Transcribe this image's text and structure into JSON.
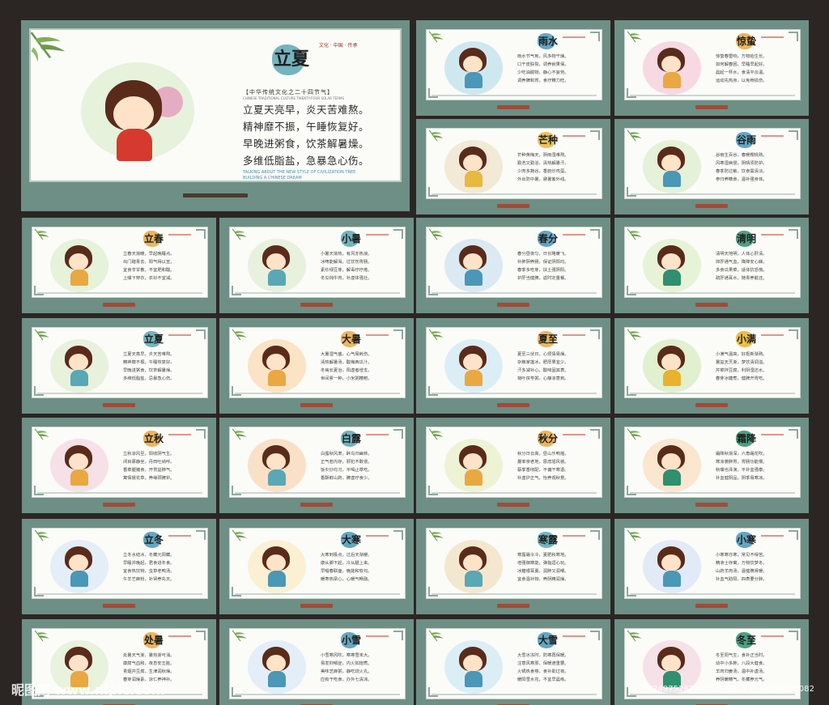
{
  "main_board": {
    "term": "立夏",
    "head_cn": "【中华传统文化之二十四节气】",
    "head_en": "CHINESE TRADITIONAL CULTURE TWENTY-FOUR SOLAR TERMS",
    "poem": [
      "立夏天亮早，炎天苦难熬。",
      "精神靡不振，午睡恢复好。",
      "早晚进粥食，饮茶解暑燥。",
      "多维低脂盐，急暴急心伤。"
    ],
    "tag_en_1": "TALKING ABOUT THE NEW STYLE OF CIVILIZATION TREE",
    "tag_en_2": "BUILDING A CHINESE DREAM",
    "seal": "文化 · 中国 · 传承"
  },
  "boards": [
    {
      "term": "雨水",
      "lines": [
        "雨水节气到，风多物干燥。",
        "口干皮肤裂，调养就果保。",
        "少吃油腻物，静心不妄劳。",
        "调养脾和胃，食疗精力旺。"
      ],
      "char": "boy-leaf",
      "splash": "#cfe8f0",
      "blob": "#4a97b7"
    },
    {
      "term": "惊蛰",
      "lines": [
        "惊蛰春雷响，万物始生长。",
        "如何解春困，早睡早起好。",
        "晨起一杯水，食清平淡温。",
        "运动先热身，以免骨损伤。"
      ],
      "char": "girl-red",
      "splash": "#f6d9e3",
      "blob": "#e9a842"
    },
    {
      "term": "芒种",
      "lines": [
        "芒种黄梅天，阴雨湿难熬。",
        "勤洗又勤浴，清热解暑汗。",
        "少肉多蔬谷，香韵炒鸡蛋。",
        "外出防中暑，避暑紫外线。"
      ],
      "char": "cow",
      "splash": "#f2e9d6",
      "blob": "#e8b840"
    },
    {
      "term": "谷雨",
      "lines": [
        "谷雨生百谷，春暖樱桃熟。",
        "风寒湿病侵，阴晴须防护。",
        "春季防过敏，饮食需清淡。",
        "参归养精食，温补强身体。"
      ],
      "char": "hat-boy",
      "splash": "#e5f1d8",
      "blob": "#4a97b7"
    },
    {
      "term": "立春",
      "lines": [
        "立春天渐暖，早起晚睡点。",
        "出门踏青去，阳气得以宣。",
        "宜食辛甘散，不宜肥和酸。",
        "上嘴下穿衣，衣衫不宜减。"
      ],
      "char": "girl-bun",
      "splash": "#e6f2d9",
      "blob": "#e9a842"
    },
    {
      "term": "小暑",
      "lines": [
        "小暑天渐热，有风亦热浪。",
        "冰啤能解渴，过饮伤胃肠。",
        "素炒绿豆芽，解毒疗疗疮。",
        "冬瓜炖牛肉，补虚体强壮。"
      ],
      "char": "girl-helmet",
      "splash": "#e8f1de",
      "blob": "#5aa7b5"
    },
    {
      "term": "春分",
      "lines": [
        "春分昼夜匀，日长略暖飞。",
        "补肺阴养肠，保证阴阳均。",
        "春季多吃芽，扶土强阴阳。",
        "护肝当健脾，返时定量餐。"
      ],
      "char": "sheep",
      "splash": "#dbe9f3",
      "blob": "#4a97b7"
    },
    {
      "term": "清明",
      "lines": [
        "清明天地明，人体心肝清。",
        "抑肝通气血，降降安心寐。",
        "多食瓜果菜，适体抗恐慌。",
        "疏肝通耳水，随青养脏还。"
      ],
      "char": "green-boy",
      "splash": "#e7f3d6",
      "blob": "#2f8f6e"
    },
    {
      "term": "立夏",
      "lines": [
        "立夏天亮早，炎天苦难熬。",
        "精神靡不振，午睡恢复好。",
        "早晚进粥食，饮茶解暑燥。",
        "多维低脂盐，忌暴急心伤。"
      ],
      "char": "girl-bun-red",
      "splash": "#e8f1dc",
      "blob": "#5aa7b5"
    },
    {
      "term": "大暑",
      "lines": [
        "大暑湿气盛，心气易耗伤。",
        "清热解暑汤，酸梅西瓜汁。",
        "冬病长夏治，阳虚者增支。",
        "世间累一种，小米粥糟粑。"
      ],
      "char": "umbrella",
      "splash": "#fbe3c6",
      "blob": "#e9a842"
    },
    {
      "term": "夏至",
      "lines": [
        "夏至三伏日，心烦情易燥。",
        "杂粮家莲冰，肥厚果宜少。",
        "汗多减补心，酸味固其表。",
        "荷叶茯苓粥，心静凉意到。"
      ],
      "char": "watermelon",
      "splash": "#dbeef6",
      "blob": "#e9a842"
    },
    {
      "term": "小满",
      "lines": [
        "小满气温高，好枢新渐熟。",
        "暑益天烹渐，梦饮清调溢。",
        "芹菜拌豆腐，利阴湿还水。",
        "春芽冰糖煮，健脾开胃吃。"
      ],
      "char": "farmer",
      "splash": "#e1f0cf",
      "blob": "#e9b22c"
    },
    {
      "term": "立秋",
      "lines": [
        "立秋凉风至，阳收阴气生。",
        "闭目慕静坐，丹田吐纳呼。",
        "香菜腿猪食，开胃益肺气。",
        "寓情嬉花草，养缘颈脾护。"
      ],
      "char": "girl-bun-red",
      "splash": "#f6e1e9",
      "blob": "#e9a842"
    },
    {
      "term": "白露",
      "lines": [
        "白露秋风肃，醉鸟归幽林。",
        "正气若内存，邪犯不敢侵。",
        "饭炎炒均习，平喝止草吃。",
        "香酥鲜山药，脾虚疗食少。"
      ],
      "char": "girl-helmet",
      "splash": "#fbe0c8",
      "blob": "#5aa7b5"
    },
    {
      "term": "秋分",
      "lines": [
        "秋分日云高，昼山乐鸭摇。",
        "蔓率亲老地，恩虑旭风装。",
        "蔡季香彻配，不偏干寒退。",
        "补虚护正气，怡养观秋景。"
      ],
      "char": "frog",
      "splash": "#eef3d6",
      "blob": "#e9a842"
    },
    {
      "term": "霜降",
      "lines": [
        "霜降秋渐深，六角霜花吹。",
        "寒凉袭肺胃，胃肠功能慢。",
        "秋嘴也泽演，平补宜强泰。",
        "补血健阴品，阴季易寒凉。"
      ],
      "char": "blond-boy",
      "splash": "#fbe6cf",
      "blob": "#2f8f6e"
    },
    {
      "term": "立冬",
      "lines": [
        "立冬水结冰，冬藏元阳藏。",
        "早睡并晚起，君食进冬食。",
        "宜食热饮物，虫草老鸭汤。",
        "午羊艺麻粉，补肾养先天。"
      ],
      "char": "girl-pink",
      "splash": "#e4eef8",
      "blob": "#4a97b7"
    },
    {
      "term": "大寒",
      "lines": [
        "大寒到极点，过后天渐暖。",
        "康从脚下起，冷从腿上来。",
        "早唱春联面，晚能和软句。",
        "暖寿热梁心，心暖气畅融。"
      ],
      "char": "girl-helmet",
      "splash": "#fbf0d4",
      "blob": "#4a97b7"
    },
    {
      "term": "寒露",
      "lines": [
        "寒露霜令冷，夏肥秋寒地。",
        "增强御寒能，弹指逗心玩。",
        "冰糖银耳羹，润肺又润喉。",
        "宜食温补物，养阴精润燥。"
      ],
      "char": "kids-play",
      "splash": "#f3e7cf",
      "blob": "#5aa7b5"
    },
    {
      "term": "小寒",
      "lines": [
        "小寒寒亦寒，常见不得苦。",
        "精液士存寓，万物饮梦冬。",
        "山药羊肉汤，温健脾肾暖。",
        "补血气助阳，四表要分肿。"
      ],
      "char": "girl-bun-red",
      "splash": "#e1eaf6",
      "blob": "#4a97b7"
    },
    {
      "term": "处暑",
      "lines": [
        "处暑天气渐，暑热渐可消。",
        "康腐气血和，夜息安五脏。",
        "青烟并豆腐，生津润秋燥。",
        "春芽润燥素，凉仁养神补。"
      ],
      "char": "bunny-girl",
      "splash": "#e9f2dc",
      "blob": "#e9a842"
    },
    {
      "term": "小雪",
      "lines": [
        "小雪寒风吹，寒寒雪未大。",
        "易发抑郁症，内火如炮煮。",
        "美味芝麻粥，静吃烧火丸。",
        "应有干吃食，办外七清凉。"
      ],
      "char": "snowman",
      "splash": "#e4eef8",
      "blob": "#4a97b7"
    },
    {
      "term": "大雪",
      "lines": [
        "大雪冰冻时，防寒再保暖。",
        "注意风寒邪，保暖遮重要。",
        "火锅热食够，食补助过夜。",
        "暖阳雪水花，不宜早晨练。"
      ],
      "char": "snow-kids",
      "splash": "#dbeef6",
      "blob": "#4a97b7"
    },
    {
      "term": "冬至",
      "lines": [
        "冬至阳气生，食补正当时。",
        "幼中小多肺，八段大健食。",
        "羊肉归姜汤，温中补虚汤。",
        "养阴暖精气，冬藏养元气。"
      ],
      "char": "girl-noodle",
      "splash": "#f6e1e9",
      "blob": "#2f8f6e"
    }
  ],
  "watermark": {
    "site": "昵图网 www.nipic.com",
    "id": "ID:24975287 NO:20201013140335274082"
  }
}
